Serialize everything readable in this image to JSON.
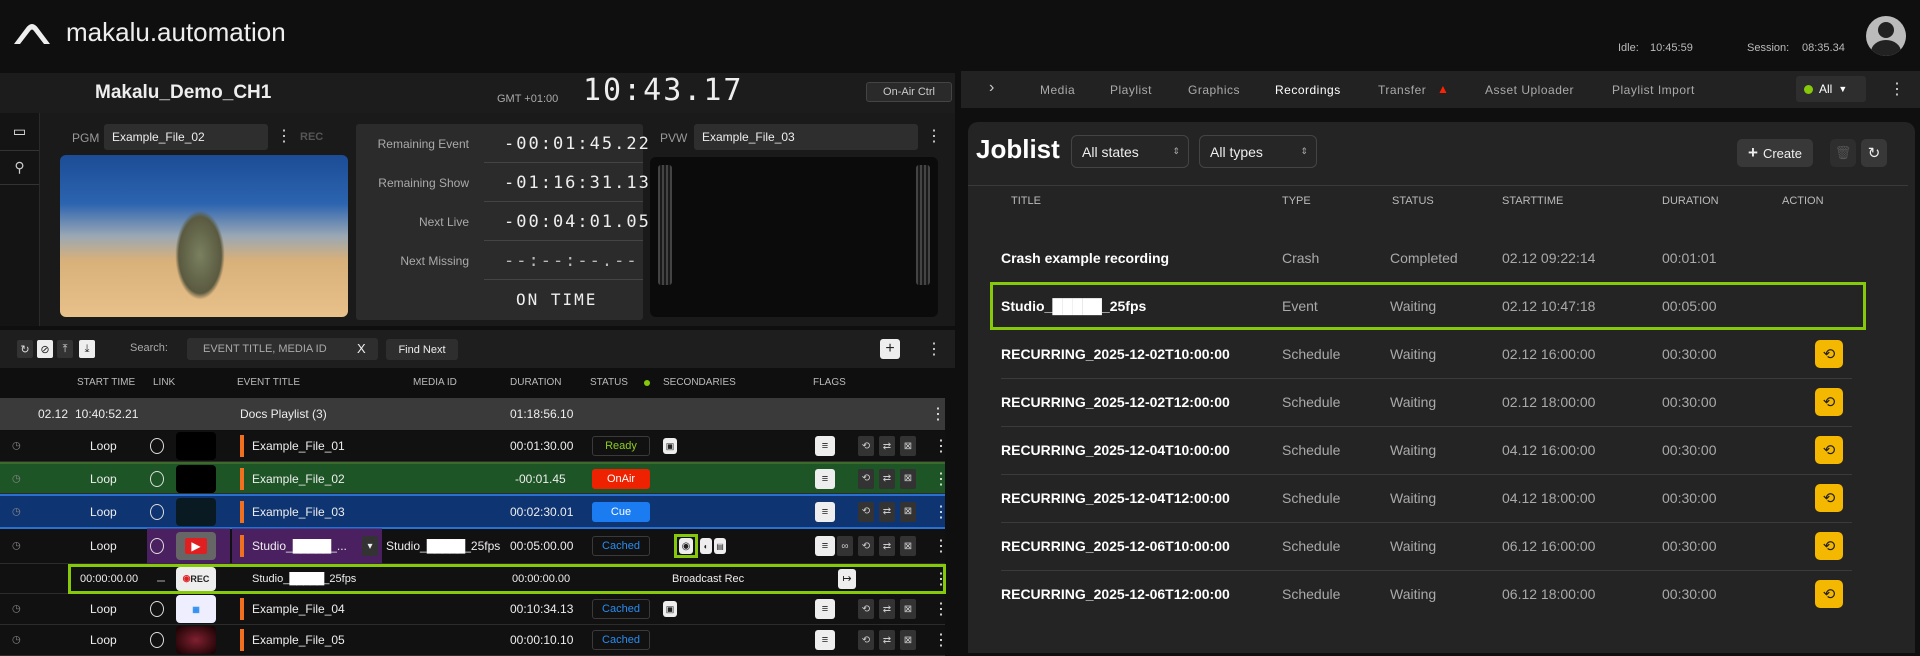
{
  "header": {
    "brand": "makalu.automation",
    "idle_label": "Idle:",
    "idle_value": "10:45:59",
    "session_label": "Session:",
    "session_value": "08:35.34"
  },
  "channel": {
    "name": "Makalu_Demo_CH1",
    "timezone": "GMT +01:00",
    "clock": "10:43.17",
    "onair_ctrl": "On-Air Ctrl"
  },
  "preview": {
    "pgm_label": "PGM",
    "pgm_file": "Example_File_02",
    "rec_label": "REC",
    "pvw_label": "PVW",
    "pvw_file": "Example_File_03",
    "info": [
      {
        "label": "Remaining Event",
        "value": "-00:01:45.22"
      },
      {
        "label": "Remaining Show",
        "value": "-01:16:31.13"
      },
      {
        "label": "Next Live",
        "value": "-00:04:01.05"
      },
      {
        "label": "Next Missing",
        "value": "--:--:--.--"
      }
    ],
    "status": "ON TIME"
  },
  "toolbar": {
    "search_label": "Search:",
    "search_placeholder": "EVENT TITLE, MEDIA ID",
    "clear": "X",
    "find_next": "Find Next",
    "add": "+"
  },
  "columns": {
    "start_time": "START TIME",
    "link": "LINK",
    "event_title": "EVENT TITLE",
    "media_id": "MEDIA ID",
    "duration": "DURATION",
    "status": "STATUS",
    "secondaries": "SECONDARIES",
    "flags": "FLAGS"
  },
  "playlist_header": {
    "date": "02.12",
    "time": "10:40:52.21",
    "title": "Docs Playlist (3)",
    "duration": "01:18:56.10"
  },
  "rows": [
    {
      "start": "Loop",
      "title": "Example_File_01",
      "media_id": "",
      "duration": "00:01:30.00",
      "status": "Ready"
    },
    {
      "start": "Loop",
      "title": "Example_File_02",
      "media_id": "",
      "duration": "-00:01.45",
      "status": "OnAir"
    },
    {
      "start": "Loop",
      "title": "Example_File_03",
      "media_id": "",
      "duration": "00:02:30.01",
      "status": "Cue"
    },
    {
      "start": "Loop",
      "title_prefix": "Studio_",
      "title_redacted": "█████",
      "title_suffix": "_...",
      "media_prefix": "Studio_",
      "media_redacted": "█████",
      "media_suffix": "_25fps",
      "duration": "00:05:00.00",
      "status": "Cached"
    },
    {
      "start": "Loop",
      "title": "Example_File_04",
      "media_id": "",
      "duration": "00:10:34.13",
      "status": "Cached"
    },
    {
      "start": "Loop",
      "title": "Example_File_05",
      "media_id": "",
      "duration": "00:00:10.10",
      "status": "Cached"
    }
  ],
  "secondary_row": {
    "start": "00:00:00.00",
    "rec": "REC",
    "title_prefix": "Studio_",
    "title_redacted": "█████",
    "title_suffix": "_25fps",
    "duration": "00:00:00.00",
    "secondary": "Broadcast Rec"
  },
  "tabs": {
    "items": [
      "Media",
      "Playlist",
      "Graphics",
      "Recordings",
      "Transfer",
      "Asset Uploader",
      "Playlist Import"
    ],
    "active": "Recordings",
    "filter": "All"
  },
  "joblist": {
    "title": "Joblist",
    "state_filter": "All states",
    "type_filter": "All types",
    "create": "Create",
    "headers": [
      "TITLE",
      "TYPE",
      "STATUS",
      "STARTTIME",
      "DURATION",
      "ACTION"
    ],
    "jobs": [
      {
        "title": "Crash example recording",
        "type": "Crash",
        "status": "Completed",
        "start": "02.12 09:22:14",
        "duration": "00:01:01",
        "action": false
      },
      {
        "title": "Studio_█████_25fps",
        "type": "Event",
        "status": "Waiting",
        "start": "02.12 10:47:18",
        "duration": "00:05:00",
        "action": false
      },
      {
        "title": "RECURRING_2025-12-02T10:00:00",
        "type": "Schedule",
        "status": "Waiting",
        "start": "02.12 16:00:00",
        "duration": "00:30:00",
        "action": true
      },
      {
        "title": "RECURRING_2025-12-02T12:00:00",
        "type": "Schedule",
        "status": "Waiting",
        "start": "02.12 18:00:00",
        "duration": "00:30:00",
        "action": true
      },
      {
        "title": "RECURRING_2025-12-04T10:00:00",
        "type": "Schedule",
        "status": "Waiting",
        "start": "04.12 16:00:00",
        "duration": "00:30:00",
        "action": true
      },
      {
        "title": "RECURRING_2025-12-04T12:00:00",
        "type": "Schedule",
        "status": "Waiting",
        "start": "04.12 18:00:00",
        "duration": "00:30:00",
        "action": true
      },
      {
        "title": "RECURRING_2025-12-06T10:00:00",
        "type": "Schedule",
        "status": "Waiting",
        "start": "06.12 16:00:00",
        "duration": "00:30:00",
        "action": true
      },
      {
        "title": "RECURRING_2025-12-06T12:00:00",
        "type": "Schedule",
        "status": "Waiting",
        "start": "06.12 18:00:00",
        "duration": "00:30:00",
        "action": true
      }
    ]
  },
  "colors": {
    "highlight": "#86c80a",
    "onair": "#ee2200",
    "cue": "#1a7cf0",
    "ready": "#8ccc20",
    "cached": "#2a8cf0",
    "action": "#f5b800",
    "warning": "#ff2200"
  }
}
